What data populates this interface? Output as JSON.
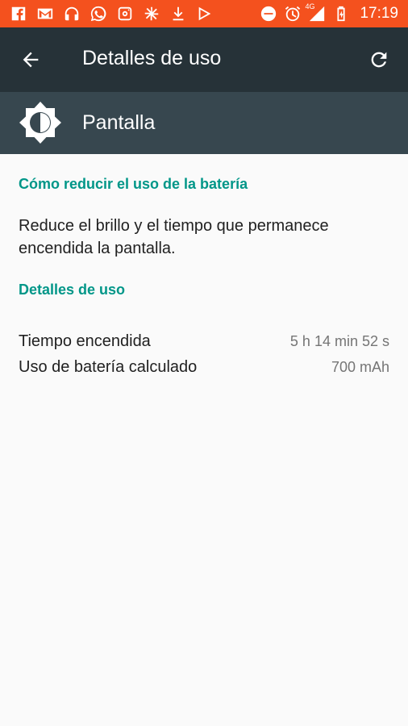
{
  "status_bar": {
    "time": "17:19",
    "network_label": "4G",
    "icons": [
      "facebook-icon",
      "gmail-icon",
      "headphones-icon",
      "whatsapp-icon",
      "instagram-icon",
      "pinwheel-icon",
      "download-icon",
      "play-store-icon",
      "do-not-disturb-icon",
      "alarm-icon",
      "signal-icon",
      "battery-charging-icon"
    ]
  },
  "app_bar": {
    "title": "Detalles de uso"
  },
  "header": {
    "title": "Pantalla"
  },
  "tips": {
    "section_title": "Cómo reducir el uso de la batería",
    "text": "Reduce el brillo y el tiempo que permanece encendida la pantalla."
  },
  "details": {
    "section_title": "Detalles de uso",
    "rows": [
      {
        "label": "Tiempo encendida",
        "value": "5 h 14 min 52 s"
      },
      {
        "label": "Uso de batería calculado",
        "value": "700 mAh"
      }
    ]
  },
  "colors": {
    "status_bar": "#f4511e",
    "app_bar": "#263238",
    "header_band": "#37474f",
    "accent": "#009688",
    "background": "#fafafa"
  }
}
